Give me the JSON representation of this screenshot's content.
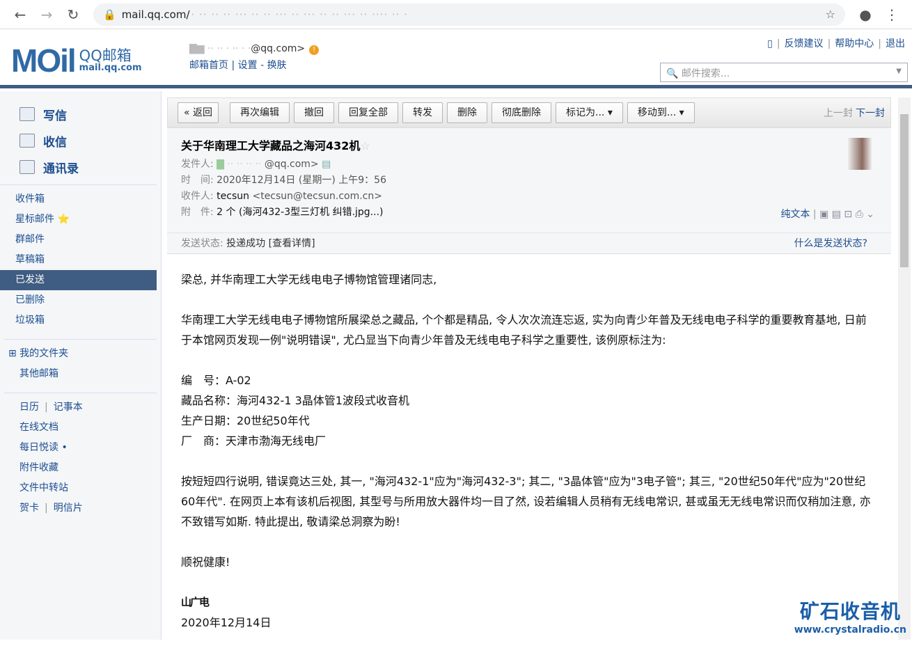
{
  "browser": {
    "url": "mail.qq.com/",
    "url_rest": "· ·· ·· ·· ··· ·· ·· ··· ·· ··· ·· ·· ··· ·· ···· ·· ·"
  },
  "header": {
    "logo": "MOil",
    "brand": "QQ邮箱",
    "domain": "mail.qq.com",
    "account": "@qq.com>",
    "links": [
      "邮箱首页",
      "设置",
      "换肤"
    ],
    "top_links": [
      "反馈建议",
      "帮助中心",
      "退出"
    ],
    "search_placeholder": "邮件搜索..."
  },
  "sidebar": {
    "primary": [
      "写信",
      "收信",
      "通讯录"
    ],
    "folders": [
      "收件箱",
      "星标邮件 ⭐",
      "群邮件",
      "草稿箱",
      "已发送",
      "已删除",
      "垃圾箱"
    ],
    "my_folders": "⊞ 我的文件夹",
    "other": "其他邮箱",
    "tools": [
      "日历",
      "记事本",
      "在线文档",
      "每日悦读 •",
      "附件收藏",
      "文件中转站",
      "贺卡",
      "明信片"
    ]
  },
  "toolbar": {
    "buttons": [
      "« 返回",
      "再次编辑",
      "撤回",
      "回复全部",
      "转发",
      "删除",
      "彻底删除",
      "标记为... ▾",
      "移动到... ▾"
    ],
    "prev": "上一封",
    "next": "下一封"
  },
  "mail": {
    "subject": "关于华南理工大学藏品之海河432机",
    "sender_label": "发件人:",
    "sender": "@qq.com>",
    "time_label": "时　间:",
    "time": "2020年12月14日 (星期一) 上午9：56",
    "to_label": "收件人:",
    "to_name": "tecsun",
    "to_addr": "<tecsun@tecsun.com.cn>",
    "att_label": "附　件:",
    "att": "2 个 (海河432-3型三灯机 纠错.jpg...)",
    "plain": "纯文本",
    "status_label": "发送状态:",
    "status": "投递成功",
    "status_link": "[查看详情]",
    "status_help": "什么是发送状态?"
  },
  "body": {
    "greeting": "梁总, 并华南理工大学无线电电子博物馆管理诸同志,",
    "p1": "华南理工大学无线电电子博物馆所展梁总之藏品, 个个都是精品, 令人次次流连忘返, 实为向青少年普及无线电电子科学的重要教育基地, 日前于本馆网页发现一例\"说明错误\", 尤凸显当下向青少年普及无线电电子科学之重要性, 该例原标注为:",
    "l1": "编　号：A-02",
    "l2": "藏品名称：海河432-1 3晶体管1波段式收音机",
    "l3": "生产日期：20世纪50年代",
    "l4": "厂　商：天津市渤海无线电厂",
    "p2": "按短短四行说明, 错误竟达三处, 其一, \"海河432-1\"应为\"海河432-3\"; 其二, \"3晶体管\"应为\"3电子管\"; 其三, \"20世纪50年代\"应为\"20世纪60年代\". 在网页上本有该机后视图, 其型号与所用放大器件均一目了然, 设若编辑人员稍有无线电常识, 甚或虽无无线电常识而仅稍加注意, 亦不致错写如斯. 特此提出, 敬请梁总洞察为盼!",
    "closing": "顺祝健康!",
    "signature": "山广电",
    "date": "2020年12月14日"
  },
  "watermark": {
    "title": "矿石收音机",
    "url": "www.crystalradio.cn"
  }
}
